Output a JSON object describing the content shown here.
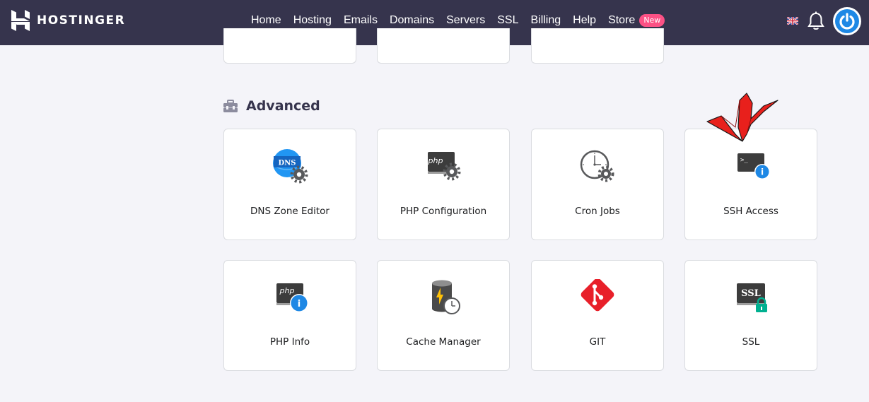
{
  "brand": {
    "name": "HOSTINGER"
  },
  "nav": {
    "items": [
      "Home",
      "Hosting",
      "Emails",
      "Domains",
      "Servers",
      "SSL",
      "Billing",
      "Help"
    ],
    "store_label": "Store",
    "store_badge": "New"
  },
  "header_icons": {
    "flag": "uk-flag-icon",
    "notifications": "bell-icon",
    "account": "power-avatar-icon"
  },
  "section": {
    "title": "Advanced",
    "icon": "toolbox-icon"
  },
  "tools": [
    {
      "label": "DNS Zone Editor",
      "icon": "dns-gear-icon"
    },
    {
      "label": "PHP Configuration",
      "icon": "php-gear-icon"
    },
    {
      "label": "Cron Jobs",
      "icon": "clock-gear-icon"
    },
    {
      "label": "SSH Access",
      "icon": "terminal-info-icon"
    },
    {
      "label": "PHP Info",
      "icon": "php-info-icon"
    },
    {
      "label": "Cache Manager",
      "icon": "database-lightning-clock-icon"
    },
    {
      "label": "GIT",
      "icon": "git-icon"
    },
    {
      "label": "SSL",
      "icon": "ssl-lock-icon"
    }
  ],
  "colors": {
    "topbar": "#36344d",
    "accent_blue": "#1e88e5",
    "badge_pink": "#fc5185",
    "git_red": "#e8202a",
    "ssl_green": "#00b090",
    "annotation_red": "#e8201c"
  },
  "annotation": {
    "icon": "red-checkmark-annotation-icon"
  }
}
